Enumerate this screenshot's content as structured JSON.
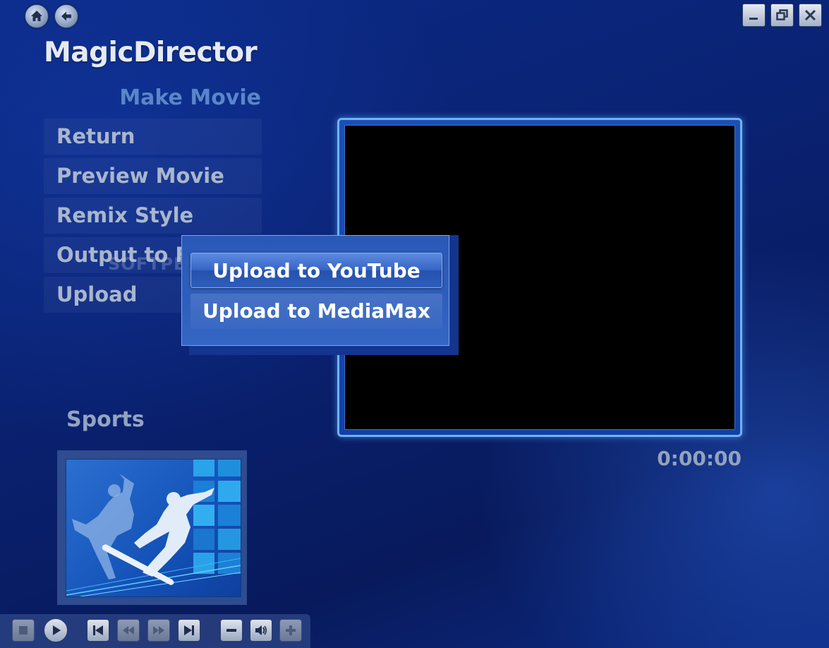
{
  "window": {
    "title": "MagicDirector",
    "icons": {
      "home": "home-icon",
      "back": "back-arrow-icon",
      "minimize": "minimize-icon",
      "restore": "restore-icon",
      "close": "close-icon"
    }
  },
  "menu": {
    "section_title": "Make Movie",
    "items": [
      {
        "label": "Return"
      },
      {
        "label": "Preview Movie"
      },
      {
        "label": "Remix Style"
      },
      {
        "label": "Output to File"
      },
      {
        "label": "Upload"
      }
    ]
  },
  "upload_popup": {
    "options": [
      {
        "label": "Upload to YouTube",
        "highlighted": true
      },
      {
        "label": "Upload to MediaMax",
        "highlighted": false
      }
    ]
  },
  "watermark": "SOFTPEDIA",
  "preview": {
    "timecode": "0:00:00"
  },
  "style": {
    "label": "Sports",
    "thumbnail": "snowboarder-thumbnail"
  },
  "player_controls": {
    "buttons": [
      "stop-icon",
      "play-icon",
      "skip-back-icon",
      "rewind-icon",
      "fast-forward-icon",
      "skip-forward-icon",
      "volume-down-icon",
      "speaker-icon",
      "volume-up-icon"
    ]
  },
  "colors": {
    "background": "#0a2170",
    "accent": "#6fb3f2",
    "section_title": "#5a86c8",
    "popup": "#2f5fbd"
  }
}
